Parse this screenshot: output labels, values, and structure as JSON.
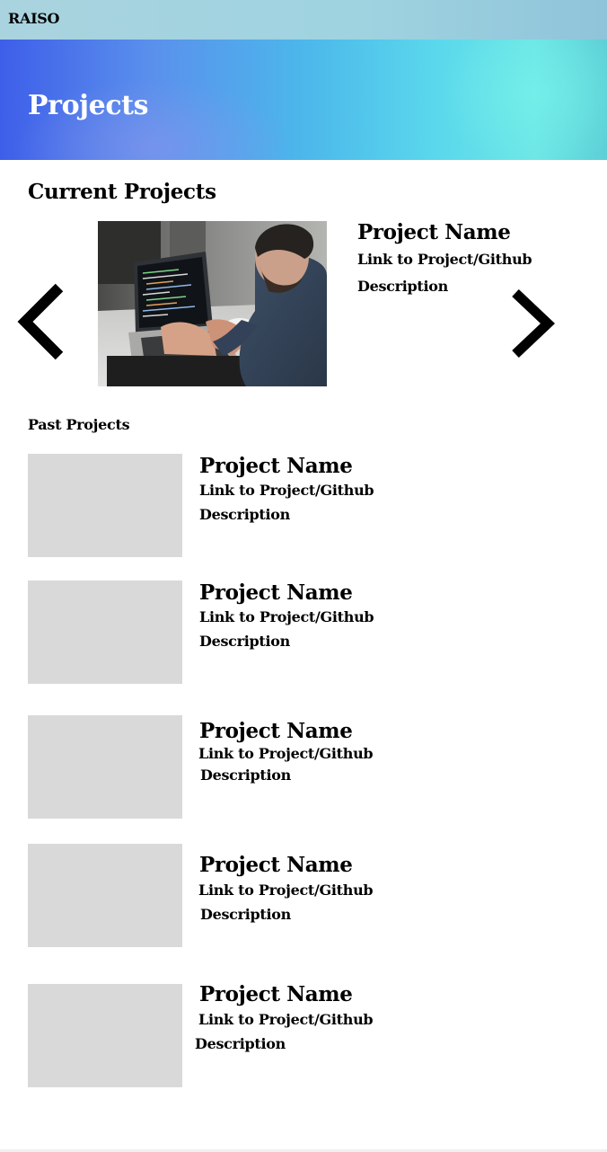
{
  "header": {
    "brand": "RAISO"
  },
  "hero": {
    "title": "Projects"
  },
  "current": {
    "section_title": "Current Projects",
    "project": {
      "name": "Project Name",
      "link": "Link to Project/Github",
      "description": "Description"
    },
    "prev_icon": "chevron-left-icon",
    "next_icon": "chevron-right-icon"
  },
  "past": {
    "section_title": "Past Projects",
    "items": [
      {
        "name": "Project Name",
        "link": "Link to Project/Github",
        "description": "Description"
      },
      {
        "name": "Project Name",
        "link": "Link to Project/Github",
        "description": "Description"
      },
      {
        "name": "Project Name",
        "link": "Link to Project/Github",
        "description": "Description"
      },
      {
        "name": "Project Name",
        "link": "Link to Project/Github",
        "description": "Description"
      },
      {
        "name": "Project Name",
        "link": "Link to Project/Github",
        "description": "Description"
      }
    ]
  },
  "colors": {
    "placeholder": "#d9d9d9",
    "hero_start": "#3e5ee9",
    "hero_end": "#6de6e6",
    "topbar": "#9fd3e0"
  }
}
